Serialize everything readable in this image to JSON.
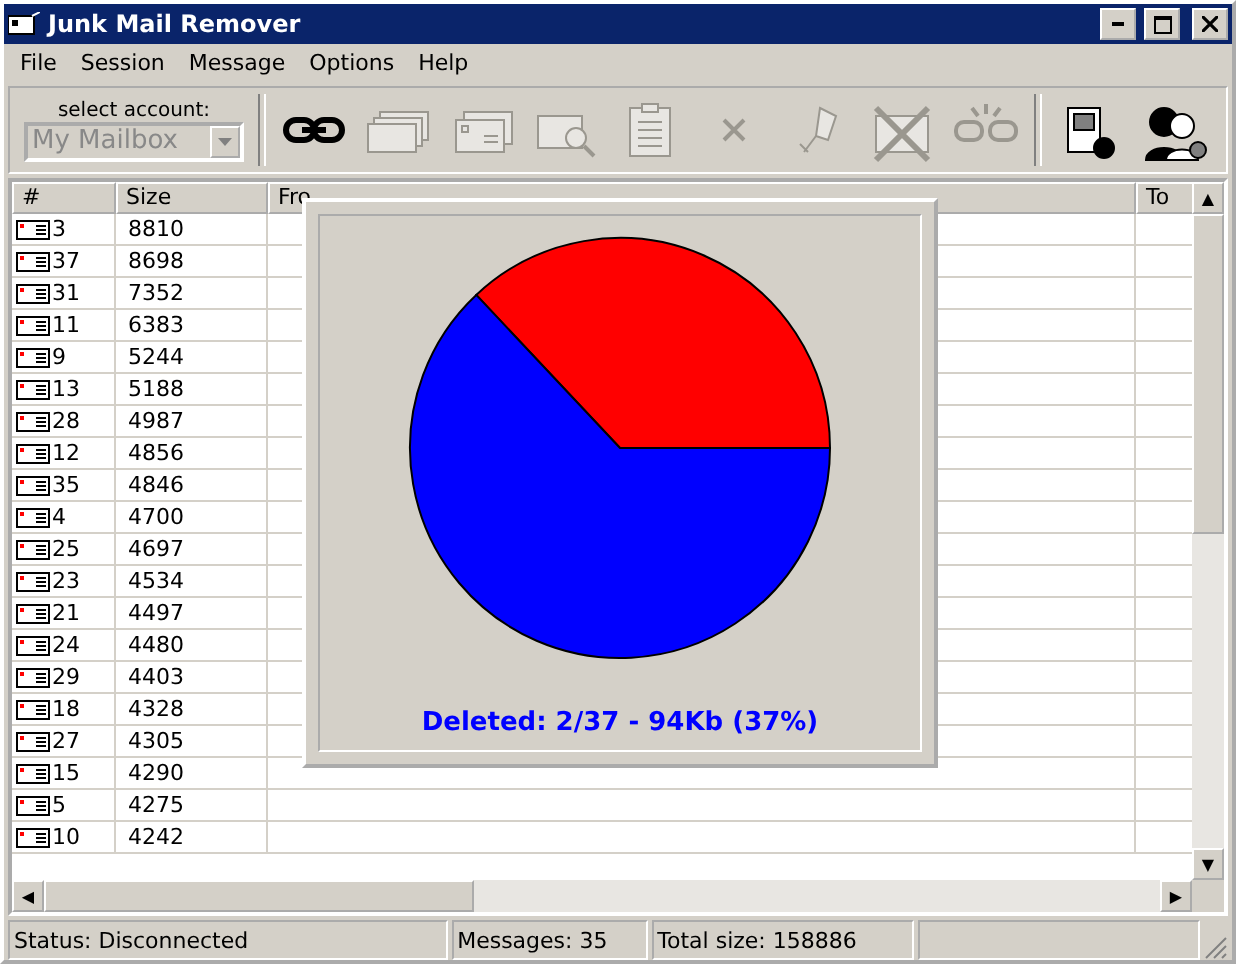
{
  "window": {
    "title": "Junk Mail Remover"
  },
  "menu": [
    "File",
    "Session",
    "Message",
    "Options",
    "Help"
  ],
  "toolbar": {
    "account_label": "select account:",
    "account": {
      "value": "My Mailbox",
      "disabled": true
    },
    "buttons": [
      {
        "kind": "link",
        "disabled": false
      },
      {
        "kind": "cards",
        "disabled": true
      },
      {
        "kind": "envelopes",
        "disabled": true
      },
      {
        "kind": "inspect",
        "disabled": true
      },
      {
        "kind": "clipboard",
        "disabled": true
      },
      {
        "kind": "delete",
        "disabled": true
      },
      {
        "kind": "pin",
        "disabled": true
      },
      {
        "kind": "nomail",
        "disabled": true
      },
      {
        "kind": "unlink",
        "disabled": true
      },
      {
        "kind": "separator"
      },
      {
        "kind": "computer",
        "disabled": false
      },
      {
        "kind": "users",
        "disabled": false
      }
    ]
  },
  "table": {
    "columns": [
      "#",
      "Size",
      "Fro",
      "To"
    ],
    "rows": [
      [
        "3",
        "8810"
      ],
      [
        "37",
        "8698"
      ],
      [
        "31",
        "7352"
      ],
      [
        "11",
        "6383"
      ],
      [
        "9",
        "5244"
      ],
      [
        "13",
        "5188"
      ],
      [
        "28",
        "4987"
      ],
      [
        "12",
        "4856"
      ],
      [
        "35",
        "4846"
      ],
      [
        "4",
        "4700"
      ],
      [
        "25",
        "4697"
      ],
      [
        "23",
        "4534"
      ],
      [
        "21",
        "4497"
      ],
      [
        "24",
        "4480"
      ],
      [
        "29",
        "4403"
      ],
      [
        "18",
        "4328"
      ],
      [
        "27",
        "4305"
      ],
      [
        "15",
        "4290"
      ],
      [
        "5",
        "4275"
      ],
      [
        "10",
        "4242"
      ]
    ]
  },
  "summary": {
    "caption": "Deleted: 2/37 - 94Kb (37%)",
    "chart_data": {
      "type": "pie",
      "values": [
        37,
        63
      ]
    }
  },
  "status_bar": [
    "Status: Disconnected",
    "Messages: 35",
    "Total size: 158886"
  ],
  "scroll_arrows": {
    "up": "▲",
    "down": "▼",
    "left": "◀",
    "right": "▶"
  }
}
